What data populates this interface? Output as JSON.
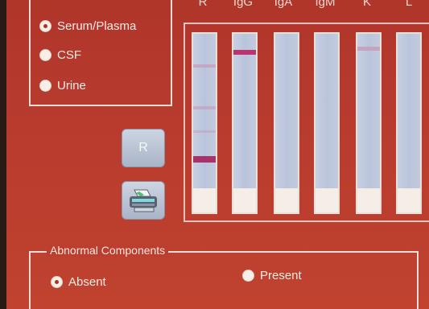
{
  "sample_type": {
    "options": [
      {
        "label": "Serum/Plasma",
        "selected": true
      },
      {
        "label": "CSF",
        "selected": false
      },
      {
        "label": "Urine",
        "selected": false
      }
    ]
  },
  "strips": {
    "headers": [
      "R",
      "IgG",
      "IgA",
      "IgM",
      "K",
      "L"
    ]
  },
  "buttons": {
    "r_label": "R",
    "printer_icon": "printer-icon"
  },
  "abnormal_components": {
    "title": "Abnormal Components",
    "options": [
      {
        "label": "Absent",
        "selected": true
      },
      {
        "label": "Present",
        "selected": false
      }
    ]
  },
  "colors": {
    "background": "#b83b2e",
    "strip": "#bec7dc",
    "band": "#b03a6a"
  }
}
